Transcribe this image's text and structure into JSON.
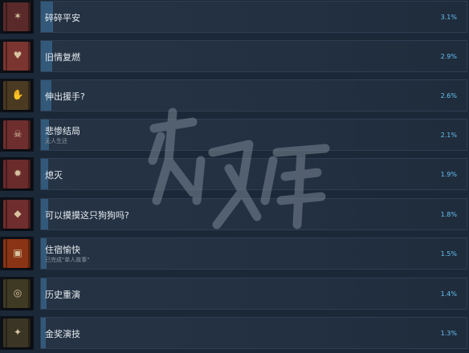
{
  "achievements": [
    {
      "name": "碎碎平安",
      "subtitle": "",
      "percent": "3.1%",
      "percent_value": 3.1,
      "book_color": "#5a2a2a",
      "emblem": "scribble-icon"
    },
    {
      "name": "旧情复燃",
      "subtitle": "",
      "percent": "2.9%",
      "percent_value": 2.9,
      "book_color": "#7a3530",
      "emblem": "heart-icon"
    },
    {
      "name": "伸出援手?",
      "subtitle": "",
      "percent": "2.6%",
      "percent_value": 2.6,
      "book_color": "#4a3a22",
      "emblem": "hand-icon"
    },
    {
      "name": "悲惨结局",
      "subtitle": "无人生还",
      "percent": "2.1%",
      "percent_value": 2.1,
      "book_color": "#6e2e2e",
      "emblem": "skull-icon"
    },
    {
      "name": "熄灭",
      "subtitle": "",
      "percent": "1.9%",
      "percent_value": 1.9,
      "book_color": "#6a2b2b",
      "emblem": "flame-icon"
    },
    {
      "name": "可以摸摸这只狗狗吗?",
      "subtitle": "",
      "percent": "1.8%",
      "percent_value": 1.8,
      "book_color": "#6f2d2d",
      "emblem": "dog-icon"
    },
    {
      "name": "住宿愉快",
      "subtitle": "已完成\"单人故事\"",
      "percent": "1.5%",
      "percent_value": 1.5,
      "book_color": "#8a3416",
      "emblem": "bed-icon"
    },
    {
      "name": "历史重演",
      "subtitle": "",
      "percent": "1.4%",
      "percent_value": 1.4,
      "book_color": "#3f3a24",
      "emblem": "swirl-icon"
    },
    {
      "name": "金奖演技",
      "subtitle": "",
      "percent": "1.3%",
      "percent_value": 1.3,
      "book_color": "#3a3524",
      "emblem": "star-icon"
    }
  ],
  "colors": {
    "background": "#1b2838",
    "progress_bar": "#33597a",
    "percent_text": "#66c0f4"
  }
}
